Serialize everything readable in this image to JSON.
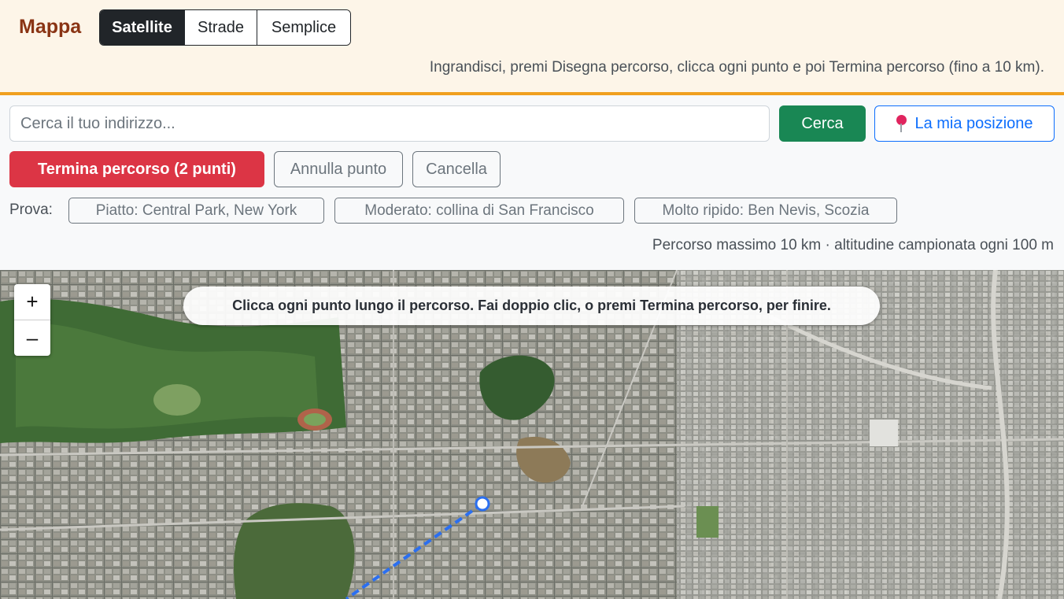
{
  "header": {
    "title": "Mappa",
    "layers": [
      "Satellite",
      "Strade",
      "Semplice"
    ],
    "active_layer": "Satellite",
    "hint": "Ingrandisci, premi Disegna percorso, clicca ogni punto e poi Termina percorso (fino a 10 km)."
  },
  "search": {
    "placeholder": "Cerca il tuo indirizzo...",
    "value": "",
    "button": "Cerca",
    "locate_button": "La mia posizione",
    "locate_icon": "map-pin-icon"
  },
  "route": {
    "finish_button": "Termina percorso (2 punti)",
    "undo_button": "Annulla punto",
    "clear_button": "Cancella"
  },
  "examples": {
    "label": "Prova:",
    "items": [
      "Piatto: Central Park, New York",
      "Moderato: collina di San Francisco",
      "Molto ripido: Ben Nevis, Scozia"
    ]
  },
  "limits": "Percorso massimo 10 km · altitudine campionata ogni 100 m",
  "map": {
    "zoom_in": "+",
    "zoom_out": "–",
    "tooltip": "Clicca ogni punto lungo il percorso. Fai doppio clic, o premi Termina percorso, per finire.",
    "route_points": 2,
    "colors": {
      "route": "#2b6ff0",
      "vertex_fill": "#ffffff"
    }
  },
  "colors": {
    "header_bg": "#fdf5e8",
    "header_border": "#f0a020",
    "title": "#8a3414",
    "primary": "#0d6efd",
    "success": "#198754",
    "danger": "#dc3545",
    "secondary": "#6c757d"
  }
}
